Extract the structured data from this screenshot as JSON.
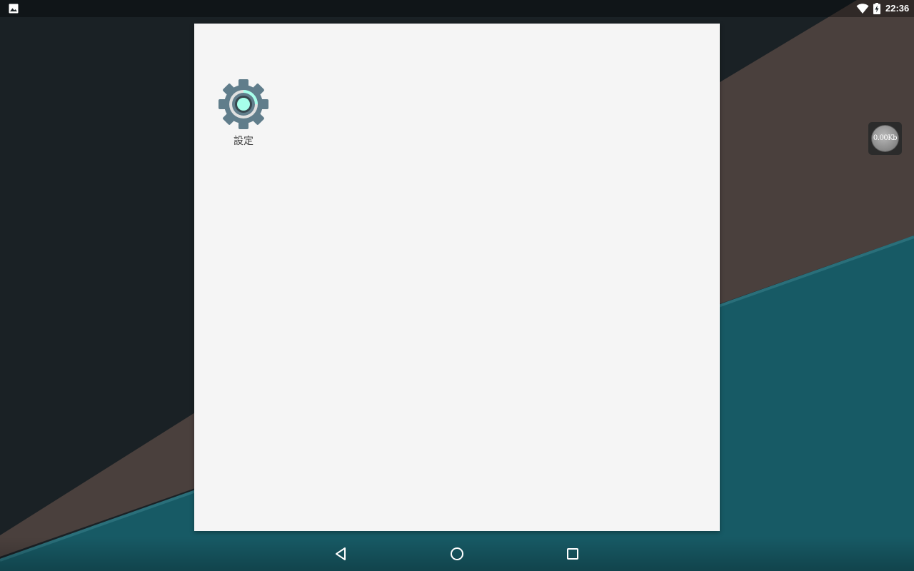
{
  "status_bar": {
    "time": "22:36",
    "left_icon": "image-notification-icon",
    "wifi_icon": "wifi-icon",
    "battery_icon": "battery-charging-icon"
  },
  "launcher": {
    "apps": [
      {
        "label": "設定",
        "icon": "settings-gear-icon"
      }
    ]
  },
  "speed_widget": {
    "value": "0.00Kb"
  },
  "nav_bar": {
    "back_icon": "back-icon",
    "home_icon": "home-icon",
    "recents_icon": "recents-icon"
  },
  "colors": {
    "panel_bg": "#f5f5f5",
    "gear_color": "#607d8b",
    "gear_accent": "#a7ffeb",
    "wallpaper_dark": "#1a2125",
    "wallpaper_brown": "#4a403d",
    "wallpaper_teal": "#175a65"
  }
}
